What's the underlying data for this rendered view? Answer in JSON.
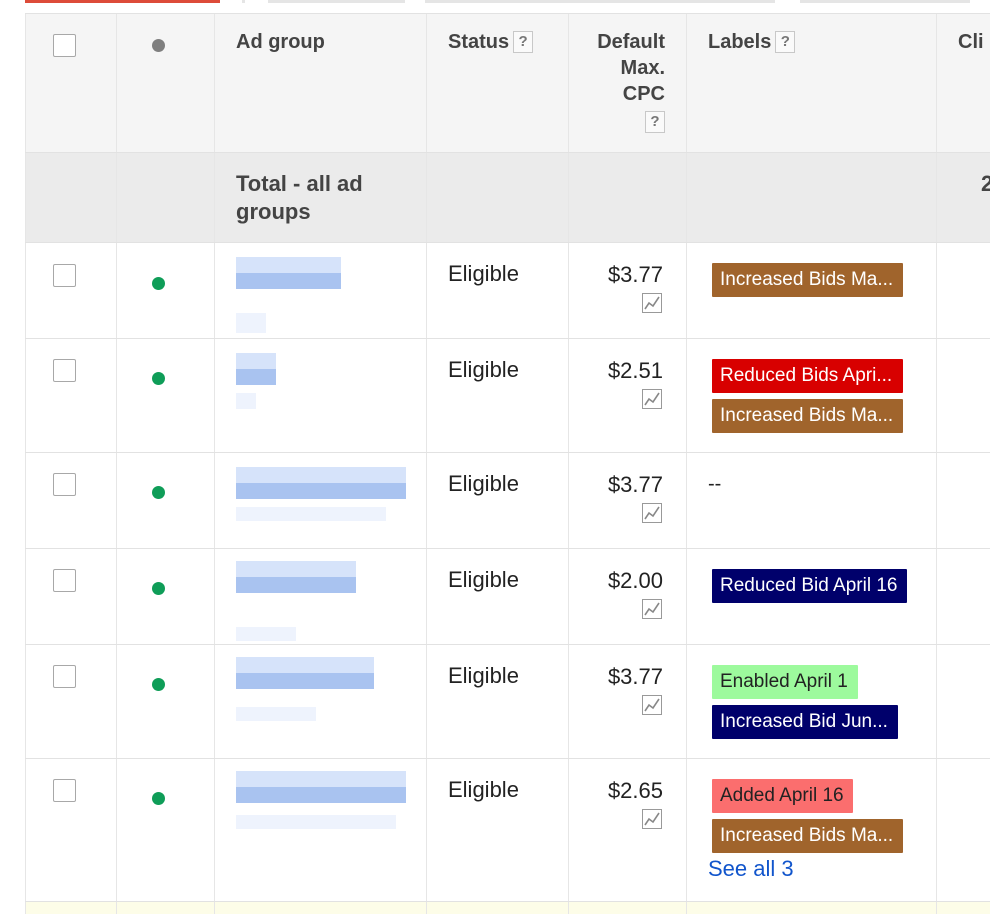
{
  "colors": {
    "label_brown": "#a0642c",
    "label_red": "#d80000",
    "label_navy": "#00006b",
    "label_lightgreen": "#9dfa9d",
    "label_salmon": "#fb6e6e",
    "status_green": "#0f9d58",
    "link_blue": "#1155cc"
  },
  "header": {
    "ad_group": "Ad group",
    "status": "Status",
    "default_max_cpc_line1": "Default",
    "default_max_cpc_line2": "Max.",
    "default_max_cpc_line3": "CPC",
    "labels": "Labels",
    "clicks": "Cli",
    "help": "?"
  },
  "total": {
    "line1": "Total - all ad",
    "line2": "groups",
    "clicks_partial": "2"
  },
  "rows": [
    {
      "status": "Eligible",
      "cpc": "$3.77",
      "labels": [
        {
          "text": "Increased Bids Ma...",
          "color": "brown"
        }
      ]
    },
    {
      "status": "Eligible",
      "cpc": "$2.51",
      "labels": [
        {
          "text": "Reduced Bids Apri...",
          "color": "red"
        },
        {
          "text": "Increased Bids Ma...",
          "color": "brown"
        }
      ]
    },
    {
      "status": "Eligible",
      "cpc": "$3.77",
      "labels_text": "--"
    },
    {
      "status": "Eligible",
      "cpc": "$2.00",
      "labels": [
        {
          "text": "Reduced Bid April 16",
          "color": "navy"
        }
      ]
    },
    {
      "status": "Eligible",
      "cpc": "$3.77",
      "labels": [
        {
          "text": "Enabled April 1",
          "color": "lightgreen"
        },
        {
          "text": "Increased Bid Jun...",
          "color": "navy"
        }
      ]
    },
    {
      "status": "Eligible",
      "cpc": "$2.65",
      "labels": [
        {
          "text": "Added April 16",
          "color": "salmon"
        },
        {
          "text": "Increased Bids Ma...",
          "color": "brown"
        }
      ],
      "see_all": "See all 3"
    }
  ],
  "icons": {
    "status_dot": "status-dot-icon",
    "chart": "trend-chart-icon",
    "help": "help-icon"
  }
}
